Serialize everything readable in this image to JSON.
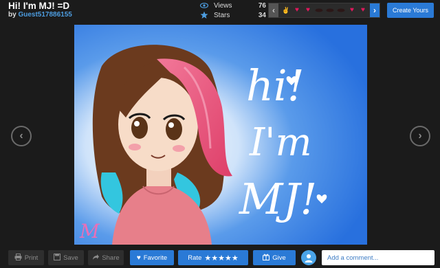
{
  "header": {
    "title": "Hi! I'm MJ! =D",
    "by_prefix": "by",
    "username": "Guest517886155"
  },
  "stats": {
    "views_label": "Views",
    "views_value": "76",
    "stars_label": "Stars",
    "stars_value": "34"
  },
  "reactions": {
    "icons": [
      "thumb-hand-icon",
      "heart-icon",
      "heart-icon",
      "lips-icon",
      "lips-icon",
      "lips-icon",
      "heart-icon",
      "heart-icon"
    ]
  },
  "create_button": {
    "label": "Create Yours"
  },
  "artwork": {
    "hand_lettering": [
      "hi!",
      "I'm",
      "MJ!"
    ],
    "signature": "M",
    "colors": {
      "background": "#2f7be6",
      "hair_brown": "#6b3a1e",
      "hair_pink": "#ec5d82",
      "hair_teal": "#33c6df",
      "shirt": "#e77f8a",
      "skin": "#f7dcc8"
    }
  },
  "toolbar": {
    "print_label": "Print",
    "save_label": "Save",
    "share_label": "Share",
    "favorite_label": "Favorite",
    "rate_label": "Rate",
    "rate_stars": "★★★★★",
    "give_label": "Give",
    "comment_placeholder": "Add a comment..."
  },
  "theme": {
    "accent": "#2a7ad6",
    "background": "#1b1b1b",
    "username": "#4d9de0"
  }
}
